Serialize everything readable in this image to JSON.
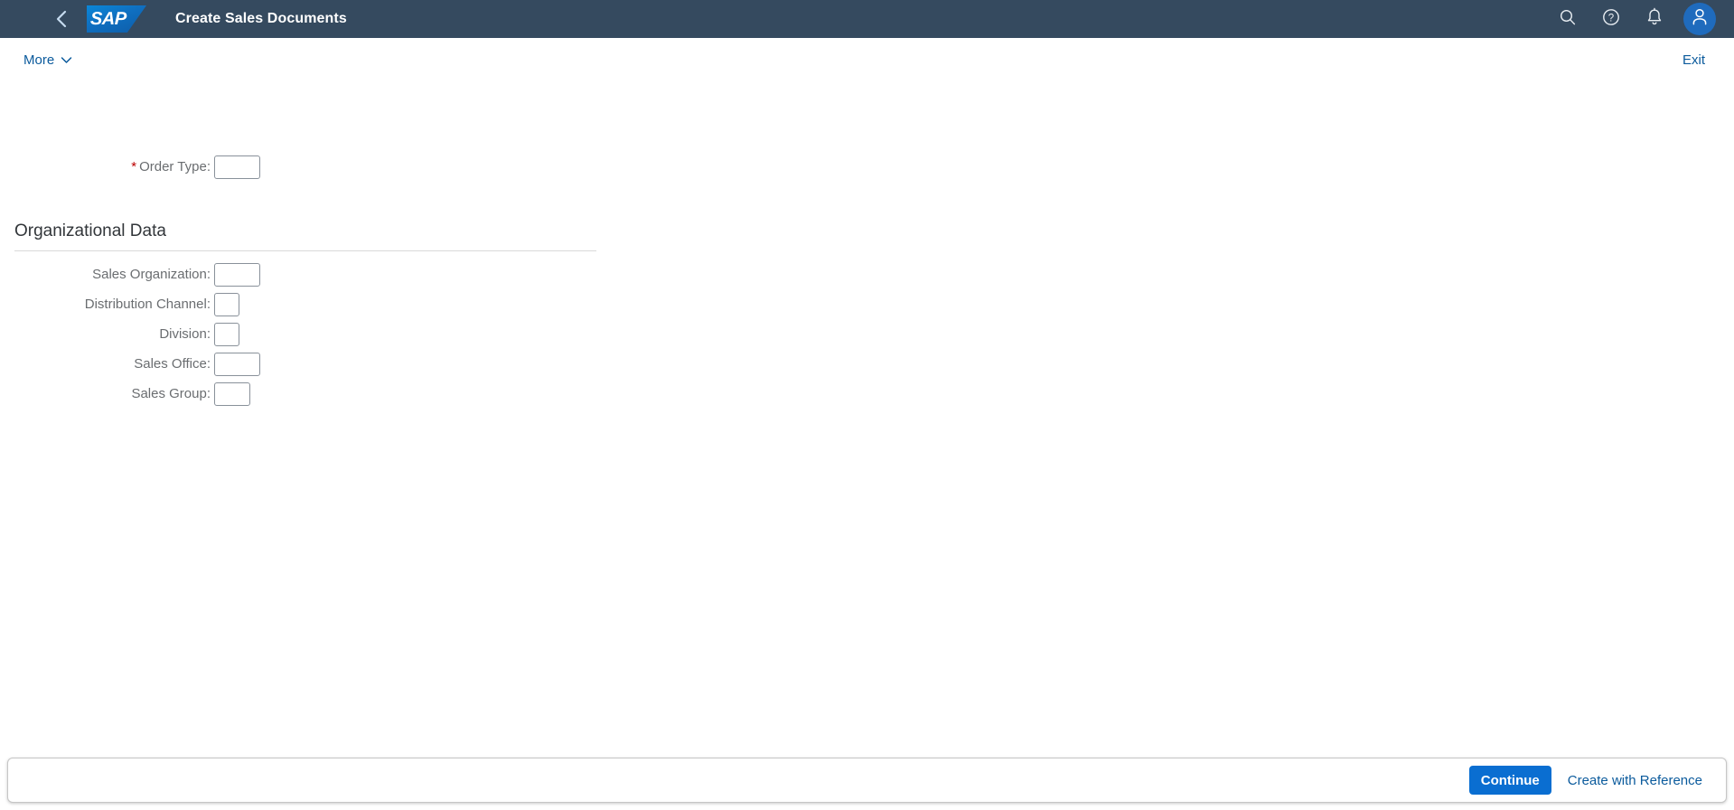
{
  "shell": {
    "title": "Create Sales Documents",
    "logo_text": "SAP",
    "back_icon": "back-chevron-icon",
    "icons": {
      "search": "search-icon",
      "help": "help-icon",
      "notifications": "bell-icon",
      "avatar": "user-avatar-icon"
    }
  },
  "toolbar": {
    "more_label": "More",
    "exit_label": "Exit"
  },
  "form": {
    "order_type": {
      "label": "Order Type:",
      "required_marker": "*",
      "value": "",
      "placeholder": ""
    },
    "section": {
      "title": "Organizational Data",
      "fields": [
        {
          "label": "Sales Organization:",
          "value": "",
          "placeholder": ""
        },
        {
          "label": "Distribution Channel:",
          "value": "",
          "placeholder": ""
        },
        {
          "label": "Division:",
          "value": "",
          "placeholder": ""
        },
        {
          "label": "Sales Office:",
          "value": "",
          "placeholder": ""
        },
        {
          "label": "Sales Group:",
          "value": "",
          "placeholder": ""
        }
      ]
    }
  },
  "footer": {
    "continue_label": "Continue",
    "create_with_reference_label": "Create with Reference"
  },
  "colors": {
    "shell_background": "#354a5f",
    "accent_blue": "#0a6ed1",
    "link_blue": "#0a5a9c",
    "required_red": "#bb0000",
    "label_gray": "#6a6d70"
  }
}
